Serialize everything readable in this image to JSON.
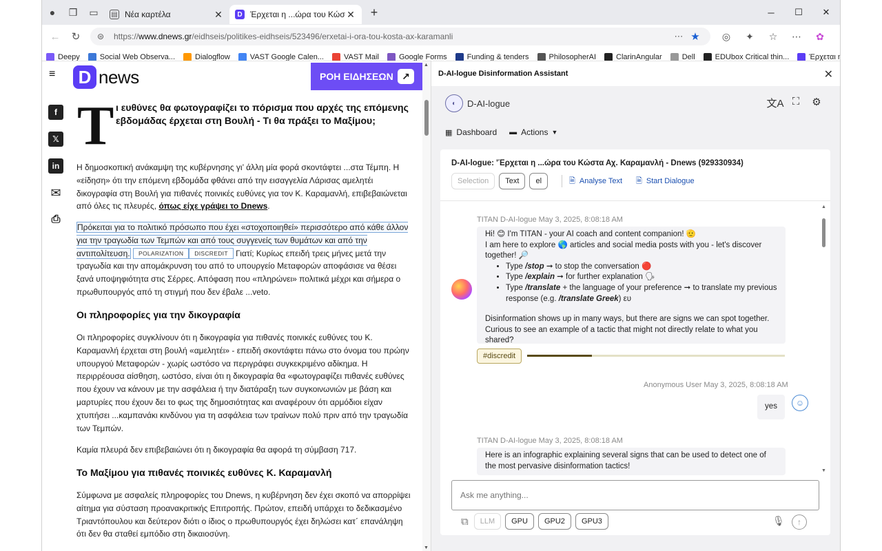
{
  "tabs": [
    {
      "title": "Νέα καρτέλα",
      "active": false
    },
    {
      "title": "Έρχεται η ...ώρα του Κώστα Αχ.",
      "active": true
    }
  ],
  "address": {
    "url_prefix": "https://",
    "url_domain": "www.dnews.gr",
    "url_path": "/eidhseis/politikes-eidhseis/523496/erxetai-i-ora-tou-kosta-ax-karamanli"
  },
  "bookmarks": [
    {
      "label": "Deepy",
      "color": "#7a5af8"
    },
    {
      "label": "Social Web Observa...",
      "color": "#3c78d8"
    },
    {
      "label": "Dialogflow",
      "color": "#ff9800"
    },
    {
      "label": "VAST Google Calen...",
      "color": "#4285f4"
    },
    {
      "label": "VAST Mail",
      "color": "#ea4335"
    },
    {
      "label": "Google Forms",
      "color": "#7e57c2"
    },
    {
      "label": "Funding & tenders",
      "color": "#1e3a8a"
    },
    {
      "label": "PhilosopherAI",
      "color": "#555555"
    },
    {
      "label": "ClarinAngular",
      "color": "#222222"
    },
    {
      "label": "Dell",
      "color": "#999999"
    },
    {
      "label": "EDUbox Critical thin...",
      "color": "#222222"
    },
    {
      "label": "Έρχεται η ...ώρα το...",
      "color": "#5b3df5"
    }
  ],
  "site": {
    "logo_letter": "D",
    "logo_text": "news",
    "live_button": "ΡΟΗ ΕΙΔΗΣΕΩΝ"
  },
  "share_icons": [
    "facebook-icon",
    "x-icon",
    "linkedin-icon",
    "mail-icon",
    "print-icon"
  ],
  "article": {
    "dropcap": "Τ",
    "headline": "ι ευθύνες θα φωτογραφίζει το πόρισμα που αρχές της επόμενης εβδομάδας έρχεται στη Βουλή - Τι θα πράξει το Μαξίμου;",
    "p1": "Η δημοσκοπική ανάκαμψη της κυβέρνησης γι’ άλλη μία φορά σκοντάφτει ...στα Τέμπη. Η «είδηση» ότι την επόμενη εβδομάδα φθάνει από την εισαγγελία Λάρισας αμελητέι δικογραφία στη Βουλή για πιθανές ποινικές ευθύνες για τον Κ. Καραμανλή, επιβεβαιώνεται από όλες τις πλευρές,",
    "p1_link": "όπως είχε γράψει το Dnews",
    "p2_highlight": "Πρόκειται για το πολιτικό πρόσωπο που έχει «στοχοποιηθεί» περισσότερο από κάθε άλλον για την τραγωδία των Τεμπών και από τους συγγενείς των θυμάτων και από την αντιπολίτευση.",
    "tag1": "POLARIZATION",
    "tag2": "DISCREDIT",
    "p2_rest": "Γιατί; Κυρίως επειδή τρεις μήνες μετά την τραγωδία και την απομάκρυνση του από το υπουργείο Μεταφορών αποφάσισε να θέσει ξανά υποψηφιότητα στις Σέρρες. Απόφαση που «πληρώνει» πολιτικά μέχρι και σήμερα ο πρωθυπουργός από τη στιγμή που δεν έβαλε ...veto.",
    "h2_1": "Οι πληροφορίες για την δικογραφία",
    "p3": "Οι πληροφορίες συγκλίνουν ότι η δικογραφία για πιθανές ποινικές ευθύνες του Κ. Καραμανλή έρχεται στη βουλή «αμελητέι» - επειδή σκοντάφτει πάνω στο όνομα του πρώην υπουργού Μεταφορών - χωρίς ωστόσο να περιγράφει συγκεκριμένο αδίκημα. Η περιρρέουσα αίσθηση, ωστόσο, είναι ότι η δικογραφία θα «φωτογραφίζει πιθανές ευθύνες που έχουν να κάνουν με την ασφάλεια ή την διατάραξη των συγκοινωνιών με βάση και μαρτυρίες που έχουν δει το φως της δημοσιότητας και αναφέρουν ότι αρμόδιοι είχαν χτυπήσει ...καμπανάκι κινδύνου για τη ασφάλεια των τραίνων πολύ πριν από την τραγωδία των Τεμπών.",
    "p4": "Καμία πλευρά δεν επιβεβαιώνει ότι η δικογραφία θα αφορά τη σύμβαση 717.",
    "h2_2": "Το Μαξίμου για πιθανές ποινικές ευθύνες Κ. Καραμανλή",
    "p5": "Σύμφωνα με ασφαλείς πληροφορίες του Dnews, η κυβέρνηση δεν έχει σκοπό να απορρίψει αίτημα για σύσταση προανακριτικής Επιτροπής. Πρώτον, επειδή υπάρχει το δεδικασμένο Τριαντόπουλου και δεύτερον διότι ο ίδιος ο πρωθυπουργός έχει δηλώσει κατ΄ επανάληψη ότι δεν θα σταθεί εμπόδιο στη δικαιοσύνη."
  },
  "panel": {
    "title": "D-AI-logue Disinformation Assistant",
    "app_name": "D-AI-logue",
    "nav_dashboard": "Dashboard",
    "nav_actions": "Actions",
    "card_title": "D-AI-logue: 'Έρχεται η ...ώρα του Κώστα Αχ. Καραμανλή - Dnews (929330934)",
    "btn_selection": "Selection",
    "btn_text": "Text",
    "btn_el": "el",
    "btn_analyse": "Analyse Text",
    "btn_start": "Start Dialogue",
    "msg1_meta": "TITAN D-AI-logue May 3, 2025, 8:08:18 AM",
    "msg1_l1": "Hi! 😊 I'm TITAN - your AI coach and content companion! 🫡",
    "msg1_l2": "I am here to explore 🌎 articles and social media posts with you - let's discover together! 🔎",
    "msg1_b1_cmd": "/stop",
    "msg1_b1_rest": " ➞ to stop the conversation 🔴",
    "msg1_b2_cmd": "/explain",
    "msg1_b2_rest": " ➞ for further explanation 🗣",
    "msg1_b3_cmd": "/translate",
    "msg1_b3_rest": " + the language of your preference ➞ to translate my previous response (e.g. ",
    "msg1_b3_example": "/translate Greek",
    "msg1_b3_end": ") ευ",
    "msg1_l3": "Disinformation shows up in many ways, but there are signs we can spot together. Curious to see an example of a tactic that might not directly relate to what you shared?",
    "type_word": "Type",
    "tag_label": "#discredit",
    "tag_progress": 0.25,
    "msg2_meta": "Anonymous User May 3, 2025, 8:08:18 AM",
    "msg2_text": "yes",
    "msg3_meta": "TITAN D-AI-logue May 3, 2025, 8:08:18 AM",
    "msg3_text": "Here is an infographic explaining several signs that can be used to detect one of the most pervasive disinformation tactics!",
    "input_placeholder": "Ask me anything...",
    "model_buttons": [
      "LLM",
      "GPU",
      "GPU2",
      "GPU3"
    ]
  }
}
